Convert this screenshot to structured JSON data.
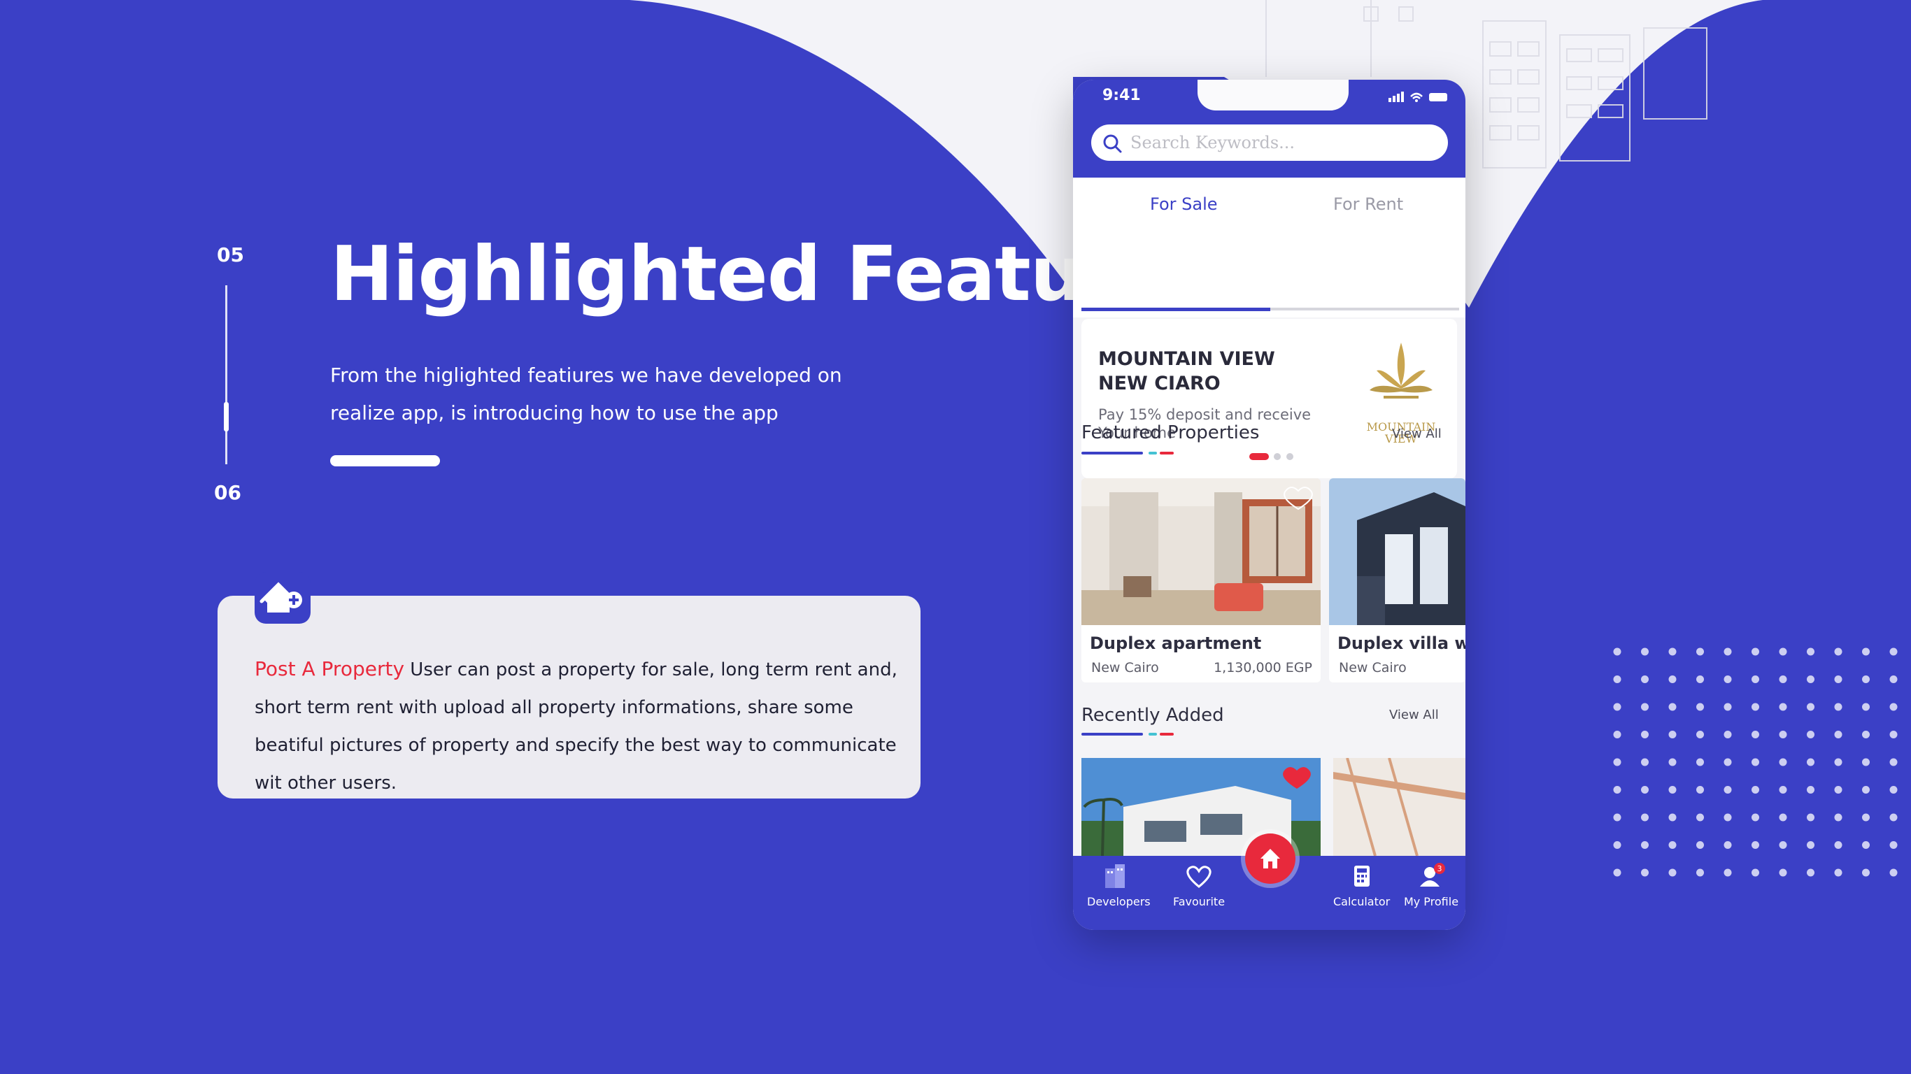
{
  "pager": {
    "current": "05",
    "next": "06"
  },
  "hero": {
    "title": "Highlighted Feature",
    "description": "From the higlighted featiures we have developed on realize app, is introducing how to use the app"
  },
  "feature_card": {
    "icon": "house-plus-icon",
    "heading": "Post A Property",
    "body": " User can post a property for sale, long term rent and, short term rent with upload all property informations, share some beatiful pictures of property and specify the best way to communicate wit other users."
  },
  "phone": {
    "status_time": "9:41",
    "search_placeholder": "Search Keywords...",
    "tabs": [
      {
        "label": "For Sale",
        "active": true
      },
      {
        "label": "For Rent",
        "active": false
      }
    ],
    "banner": {
      "title": "MOUNTAIN VIEW NEW CIARO",
      "subtitle": "Pay 15% deposit and receive Your home",
      "logo_text_1": "MOUNTAIN",
      "logo_text_2": "VIEW",
      "slide_index": 1,
      "slide_count": 3
    },
    "featured": {
      "title": "Featured Properties",
      "view_all": "View All",
      "items": [
        {
          "name": "Duplex apartment",
          "location": "New Cairo",
          "price": "1,130,000 EGP"
        },
        {
          "name": "Duplex villa wi",
          "location": "New Cairo",
          "price": ""
        }
      ]
    },
    "recent": {
      "title": "Recently Added",
      "view_all": "View All"
    },
    "nav": {
      "items": [
        {
          "label": "Developers",
          "icon": "building-icon"
        },
        {
          "label": "Favourite",
          "icon": "heart-icon"
        },
        {
          "label": "Calculator",
          "icon": "calculator-icon"
        },
        {
          "label": "My Profile",
          "icon": "user-icon",
          "badge": "3"
        }
      ],
      "center_icon": "home-icon"
    }
  },
  "colors": {
    "brand": "#3b40c6",
    "accent": "#e8293c",
    "card": "#ecebf1"
  }
}
